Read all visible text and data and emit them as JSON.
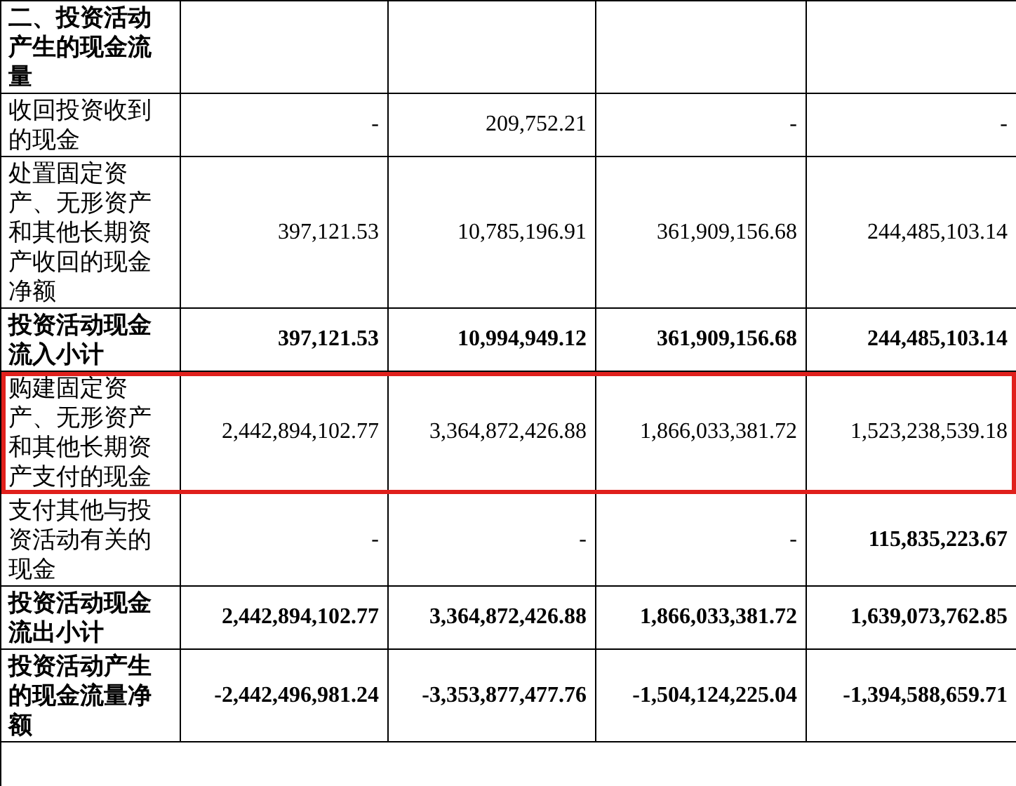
{
  "rows": [
    {
      "label": "二、投资活动产生的现金流量",
      "bold": true,
      "highlighted": false
    },
    {
      "label": "收回投资收到的现金",
      "bold": false,
      "highlighted": false,
      "values": [
        {
          "text": "-",
          "bold": false
        },
        {
          "text": "209,752.21",
          "bold": false
        },
        {
          "text": "-",
          "bold": false
        },
        {
          "text": "-",
          "bold": false
        }
      ]
    },
    {
      "label": "处置固定资产、无形资产和其他长期资产收回的现金净额",
      "bold": false,
      "highlighted": false,
      "values": [
        {
          "text": "397,121.53",
          "bold": false
        },
        {
          "text": "10,785,196.91",
          "bold": false
        },
        {
          "text": "361,909,156.68",
          "bold": false
        },
        {
          "text": "244,485,103.14",
          "bold": false
        }
      ]
    },
    {
      "label": "投资活动现金流入小计",
      "bold": true,
      "highlighted": false,
      "values": [
        {
          "text": "397,121.53",
          "bold": true
        },
        {
          "text": "10,994,949.12",
          "bold": true
        },
        {
          "text": "361,909,156.68",
          "bold": true
        },
        {
          "text": "244,485,103.14",
          "bold": true
        }
      ]
    },
    {
      "label": "购建固定资产、无形资产和其他长期资产支付的现金",
      "bold": false,
      "highlighted": true,
      "values": [
        {
          "text": "2,442,894,102.77",
          "bold": false
        },
        {
          "text": "3,364,872,426.88",
          "bold": false
        },
        {
          "text": "1,866,033,381.72",
          "bold": false
        },
        {
          "text": "1,523,238,539.18",
          "bold": false
        }
      ]
    },
    {
      "label": "支付其他与投资活动有关的现金",
      "bold": false,
      "highlighted": false,
      "values": [
        {
          "text": "-",
          "bold": false
        },
        {
          "text": "-",
          "bold": false
        },
        {
          "text": "-",
          "bold": false
        },
        {
          "text": "115,835,223.67",
          "bold": true
        }
      ]
    },
    {
      "label": "投资活动现金流出小计",
      "bold": true,
      "highlighted": false,
      "values": [
        {
          "text": "2,442,894,102.77",
          "bold": true
        },
        {
          "text": "3,364,872,426.88",
          "bold": true
        },
        {
          "text": "1,866,033,381.72",
          "bold": true
        },
        {
          "text": "1,639,073,762.85",
          "bold": true
        }
      ]
    },
    {
      "label": "投资活动产生的现金流量净额",
      "bold": true,
      "highlighted": false,
      "values": [
        {
          "text": "-2,442,496,981.24",
          "bold": true
        },
        {
          "text": "-3,353,877,477.76",
          "bold": true
        },
        {
          "text": "-1,504,124,225.04",
          "bold": true
        },
        {
          "text": "-1,394,588,659.71",
          "bold": true
        }
      ]
    }
  ]
}
